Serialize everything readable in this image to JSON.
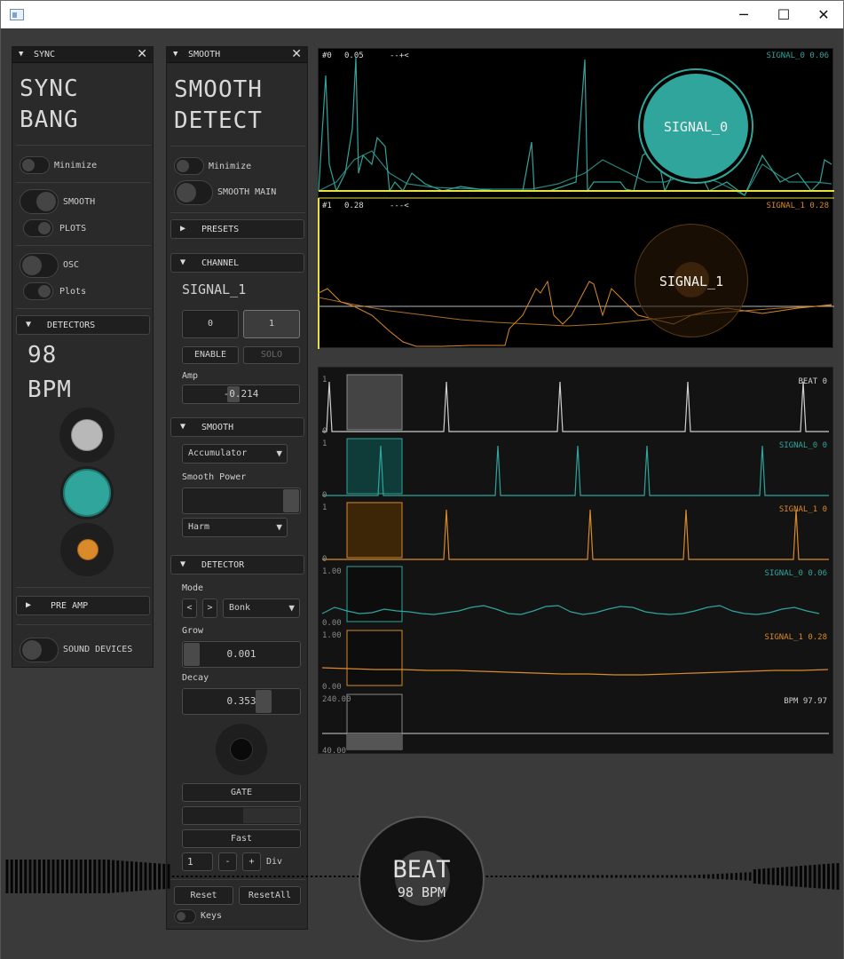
{
  "colors": {
    "teal": "#2fa59b",
    "orange": "#d98a2a",
    "yellow": "#e8e23a",
    "grey": "#b8b8b8"
  },
  "icons": {
    "app": "app-window-icon",
    "minimize": "minimize-icon",
    "maximize": "maximize-icon",
    "close": "close-icon"
  },
  "window": {
    "minimize": "─",
    "maximize": "☐",
    "close": "✕"
  },
  "sync": {
    "title": "SYNC",
    "heading1": "SYNC",
    "heading2": "BANG",
    "minimize": "Minimize",
    "smooth": "SMOOTH",
    "plots": "PLOTS",
    "osc": "OSC",
    "plots2": "Plots",
    "detectors": "DETECTORS",
    "bpm_value": "98",
    "bpm_unit": "BPM",
    "pre_amp": "PRE AMP",
    "sound_devices": "SOUND DEVICES"
  },
  "smooth": {
    "title": "SMOOTH",
    "heading1": "SMOOTH",
    "heading2": "DETECT",
    "minimize": "Minimize",
    "smooth_main": "SMOOTH MAIN",
    "presets": "PRESETS",
    "channel": "CHANNEL",
    "signal": "SIGNAL_1",
    "ch0": "0",
    "ch1": "1",
    "enable": "ENABLE",
    "solo": "SOLO",
    "amp_label": "Amp",
    "amp_value": "-0.214",
    "amp_level": 0.45,
    "smooth_section": "SMOOTH",
    "accumulator": "Accumulator",
    "smooth_power": "Smooth Power",
    "harm": "Harm",
    "detector": "DETECTOR",
    "mode": "Mode",
    "prev": "<",
    "next": ">",
    "mode_value": "Bonk",
    "grow": "Grow",
    "grow_value": "0.001",
    "decay": "Decay",
    "decay_value": "0.353",
    "decay_level": 0.353,
    "gate": "GATE",
    "fast": "Fast",
    "div_value": "1",
    "minus": "-",
    "plus": "+",
    "div": "Div",
    "reset": "Reset",
    "reset_all": "ResetAll",
    "keys": "Keys"
  },
  "top_plot": {
    "s0_index": "#0",
    "s0_value": "0.05",
    "s0_marker": "--+<",
    "s0_label": "SIGNAL_0 0.06",
    "s0_circle": "SIGNAL_0",
    "s1_index": "#1",
    "s1_value": "0.28",
    "s1_marker": "---<",
    "s1_label": "SIGNAL_1 0.28",
    "s1_circle": "SIGNAL_1"
  },
  "lower_plot": [
    {
      "label": "BEAT 0",
      "ymax": "1",
      "ymin": "0",
      "color": "#cfcfcf"
    },
    {
      "label": "SIGNAL_0 0",
      "ymax": "1",
      "ymin": "0",
      "color": "#2fa59b"
    },
    {
      "label": "SIGNAL_1 0",
      "ymax": "1",
      "ymin": "0",
      "color": "#d98a2a"
    },
    {
      "label": "SIGNAL_0 0.06",
      "ymax": "1.00",
      "ymin": "0.00",
      "color": "#2fa59b"
    },
    {
      "label": "SIGNAL_1 0.28",
      "ymax": "1.00",
      "ymin": "0.00",
      "color": "#d98a2a"
    },
    {
      "label": "BPM 97.97",
      "ymax": "240.00",
      "ymin": "40.00",
      "color": "#cfcfcf"
    }
  ],
  "beat": {
    "title": "BEAT",
    "bpm": "98 BPM"
  }
}
